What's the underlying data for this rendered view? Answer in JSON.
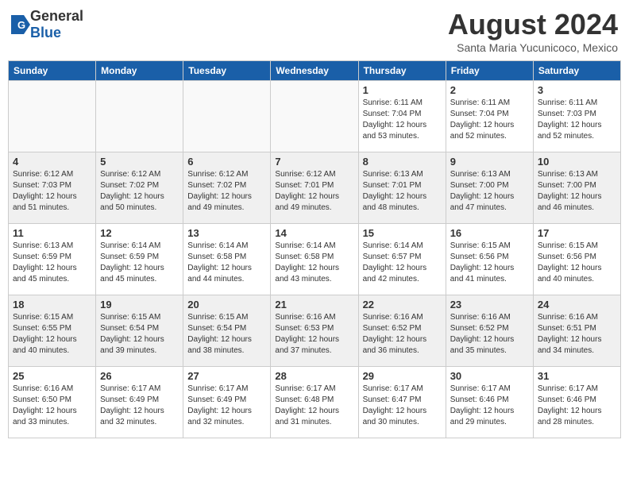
{
  "header": {
    "logo_general": "General",
    "logo_blue": "Blue",
    "title": "August 2024",
    "location": "Santa Maria Yucunicoco, Mexico"
  },
  "weekdays": [
    "Sunday",
    "Monday",
    "Tuesday",
    "Wednesday",
    "Thursday",
    "Friday",
    "Saturday"
  ],
  "weeks": [
    [
      {
        "day": "",
        "info": ""
      },
      {
        "day": "",
        "info": ""
      },
      {
        "day": "",
        "info": ""
      },
      {
        "day": "",
        "info": ""
      },
      {
        "day": "1",
        "info": "Sunrise: 6:11 AM\nSunset: 7:04 PM\nDaylight: 12 hours\nand 53 minutes."
      },
      {
        "day": "2",
        "info": "Sunrise: 6:11 AM\nSunset: 7:04 PM\nDaylight: 12 hours\nand 52 minutes."
      },
      {
        "day": "3",
        "info": "Sunrise: 6:11 AM\nSunset: 7:03 PM\nDaylight: 12 hours\nand 52 minutes."
      }
    ],
    [
      {
        "day": "4",
        "info": "Sunrise: 6:12 AM\nSunset: 7:03 PM\nDaylight: 12 hours\nand 51 minutes."
      },
      {
        "day": "5",
        "info": "Sunrise: 6:12 AM\nSunset: 7:02 PM\nDaylight: 12 hours\nand 50 minutes."
      },
      {
        "day": "6",
        "info": "Sunrise: 6:12 AM\nSunset: 7:02 PM\nDaylight: 12 hours\nand 49 minutes."
      },
      {
        "day": "7",
        "info": "Sunrise: 6:12 AM\nSunset: 7:01 PM\nDaylight: 12 hours\nand 49 minutes."
      },
      {
        "day": "8",
        "info": "Sunrise: 6:13 AM\nSunset: 7:01 PM\nDaylight: 12 hours\nand 48 minutes."
      },
      {
        "day": "9",
        "info": "Sunrise: 6:13 AM\nSunset: 7:00 PM\nDaylight: 12 hours\nand 47 minutes."
      },
      {
        "day": "10",
        "info": "Sunrise: 6:13 AM\nSunset: 7:00 PM\nDaylight: 12 hours\nand 46 minutes."
      }
    ],
    [
      {
        "day": "11",
        "info": "Sunrise: 6:13 AM\nSunset: 6:59 PM\nDaylight: 12 hours\nand 45 minutes."
      },
      {
        "day": "12",
        "info": "Sunrise: 6:14 AM\nSunset: 6:59 PM\nDaylight: 12 hours\nand 45 minutes."
      },
      {
        "day": "13",
        "info": "Sunrise: 6:14 AM\nSunset: 6:58 PM\nDaylight: 12 hours\nand 44 minutes."
      },
      {
        "day": "14",
        "info": "Sunrise: 6:14 AM\nSunset: 6:58 PM\nDaylight: 12 hours\nand 43 minutes."
      },
      {
        "day": "15",
        "info": "Sunrise: 6:14 AM\nSunset: 6:57 PM\nDaylight: 12 hours\nand 42 minutes."
      },
      {
        "day": "16",
        "info": "Sunrise: 6:15 AM\nSunset: 6:56 PM\nDaylight: 12 hours\nand 41 minutes."
      },
      {
        "day": "17",
        "info": "Sunrise: 6:15 AM\nSunset: 6:56 PM\nDaylight: 12 hours\nand 40 minutes."
      }
    ],
    [
      {
        "day": "18",
        "info": "Sunrise: 6:15 AM\nSunset: 6:55 PM\nDaylight: 12 hours\nand 40 minutes."
      },
      {
        "day": "19",
        "info": "Sunrise: 6:15 AM\nSunset: 6:54 PM\nDaylight: 12 hours\nand 39 minutes."
      },
      {
        "day": "20",
        "info": "Sunrise: 6:15 AM\nSunset: 6:54 PM\nDaylight: 12 hours\nand 38 minutes."
      },
      {
        "day": "21",
        "info": "Sunrise: 6:16 AM\nSunset: 6:53 PM\nDaylight: 12 hours\nand 37 minutes."
      },
      {
        "day": "22",
        "info": "Sunrise: 6:16 AM\nSunset: 6:52 PM\nDaylight: 12 hours\nand 36 minutes."
      },
      {
        "day": "23",
        "info": "Sunrise: 6:16 AM\nSunset: 6:52 PM\nDaylight: 12 hours\nand 35 minutes."
      },
      {
        "day": "24",
        "info": "Sunrise: 6:16 AM\nSunset: 6:51 PM\nDaylight: 12 hours\nand 34 minutes."
      }
    ],
    [
      {
        "day": "25",
        "info": "Sunrise: 6:16 AM\nSunset: 6:50 PM\nDaylight: 12 hours\nand 33 minutes."
      },
      {
        "day": "26",
        "info": "Sunrise: 6:17 AM\nSunset: 6:49 PM\nDaylight: 12 hours\nand 32 minutes."
      },
      {
        "day": "27",
        "info": "Sunrise: 6:17 AM\nSunset: 6:49 PM\nDaylight: 12 hours\nand 32 minutes."
      },
      {
        "day": "28",
        "info": "Sunrise: 6:17 AM\nSunset: 6:48 PM\nDaylight: 12 hours\nand 31 minutes."
      },
      {
        "day": "29",
        "info": "Sunrise: 6:17 AM\nSunset: 6:47 PM\nDaylight: 12 hours\nand 30 minutes."
      },
      {
        "day": "30",
        "info": "Sunrise: 6:17 AM\nSunset: 6:46 PM\nDaylight: 12 hours\nand 29 minutes."
      },
      {
        "day": "31",
        "info": "Sunrise: 6:17 AM\nSunset: 6:46 PM\nDaylight: 12 hours\nand 28 minutes."
      }
    ]
  ]
}
